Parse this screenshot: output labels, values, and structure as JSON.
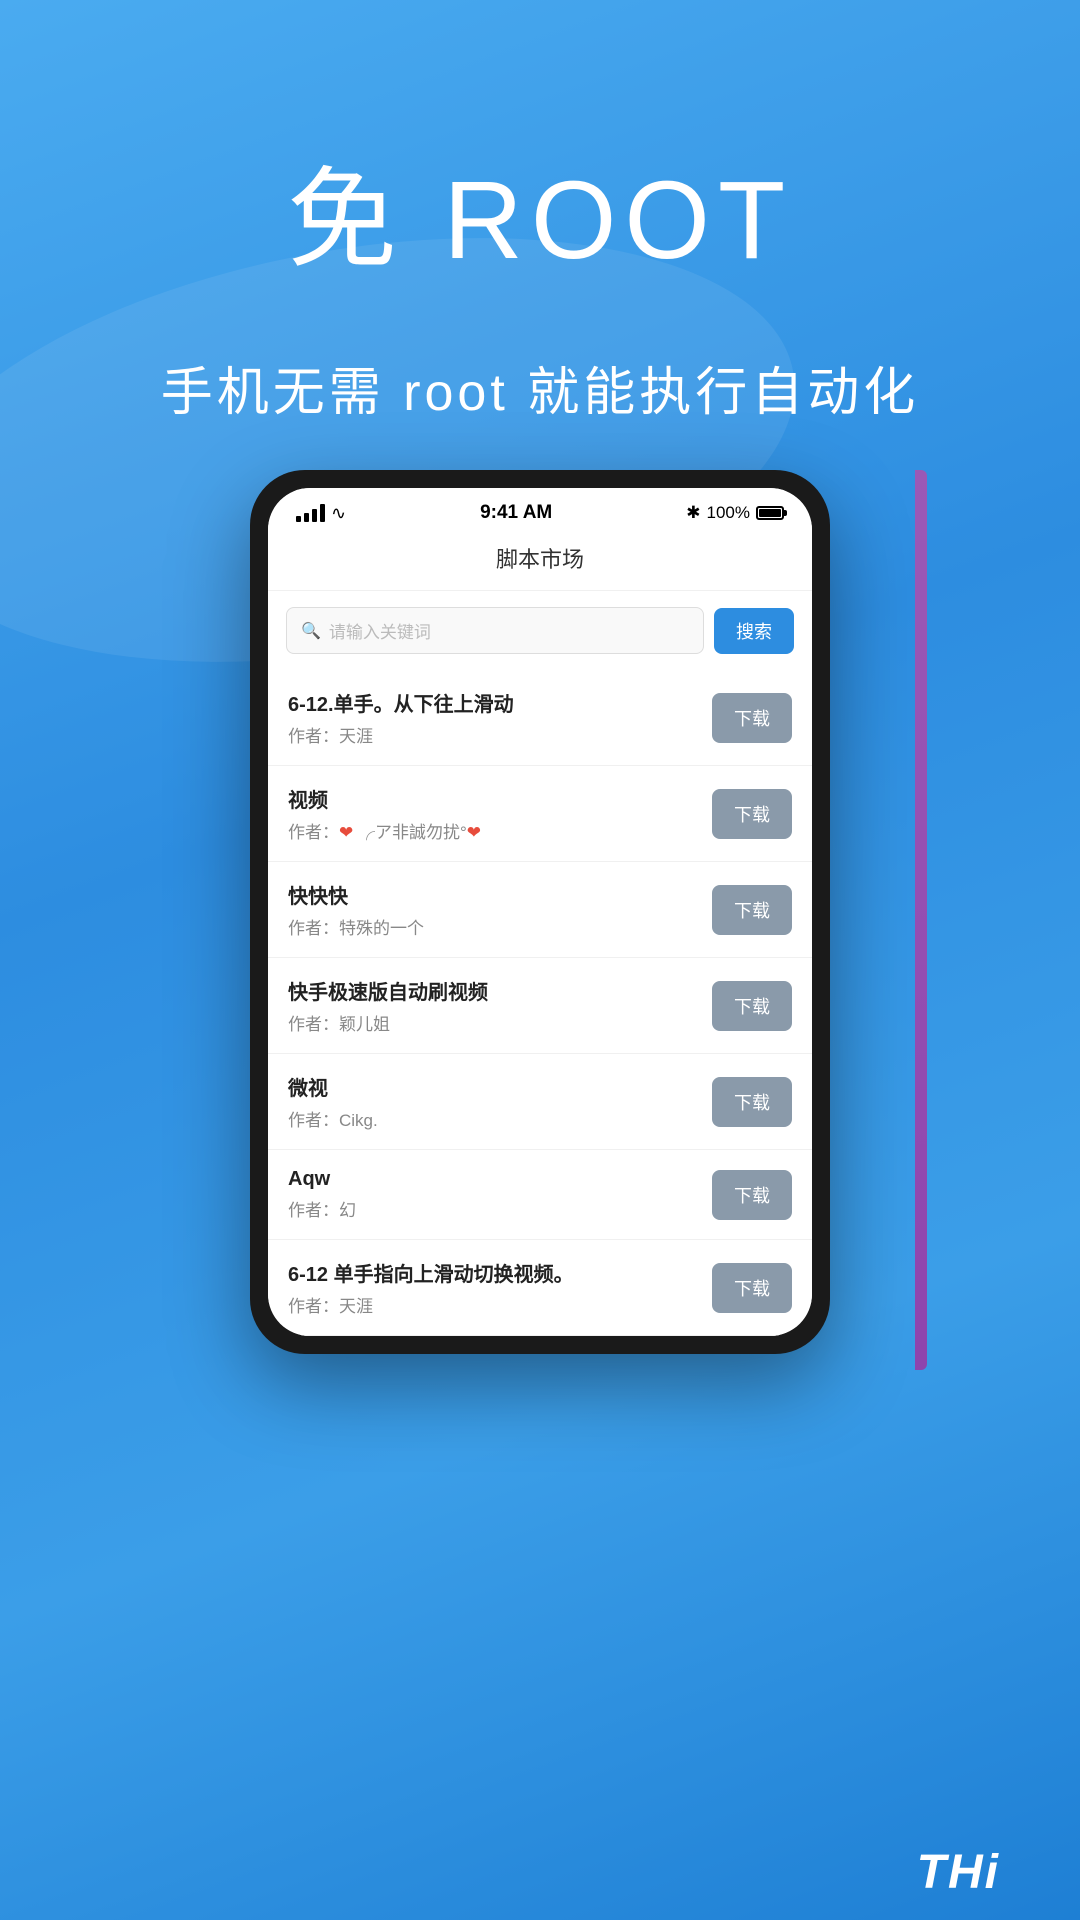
{
  "hero": {
    "title": "免 ROOT",
    "subtitle": "手机无需 root 就能执行自动化"
  },
  "status_bar": {
    "time": "9:41 AM",
    "battery_percent": "100%",
    "bluetooth": "✱"
  },
  "app": {
    "header_title": "脚本市场",
    "search_placeholder": "请输入关键词",
    "search_button_label": "搜索"
  },
  "scripts": [
    {
      "name": "6-12.单手。从下往上滑动",
      "author_prefix": "作者：",
      "author": "天涯",
      "download_label": "下载",
      "author_html": false
    },
    {
      "name": "视频",
      "author_prefix": "作者：",
      "author": "❤ ╭ア非誠勿扰°❤",
      "download_label": "下载",
      "author_html": true
    },
    {
      "name": "快快快",
      "author_prefix": "作者：",
      "author": "特殊的一个",
      "download_label": "下载",
      "author_html": false
    },
    {
      "name": "快手极速版自动刷视频",
      "author_prefix": "作者：",
      "author": "颖儿姐",
      "download_label": "下载",
      "author_html": false
    },
    {
      "name": "微视",
      "author_prefix": "作者：",
      "author": "Cikg.",
      "download_label": "下载",
      "author_html": false
    },
    {
      "name": "Aqw",
      "author_prefix": "作者：",
      "author": "幻",
      "download_label": "下载",
      "author_html": false
    },
    {
      "name": "6-12 单手指向上滑动切换视频。",
      "author_prefix": "作者：",
      "author": "天涯",
      "download_label": "下载",
      "author_html": false
    }
  ],
  "bottom_label": "THi"
}
